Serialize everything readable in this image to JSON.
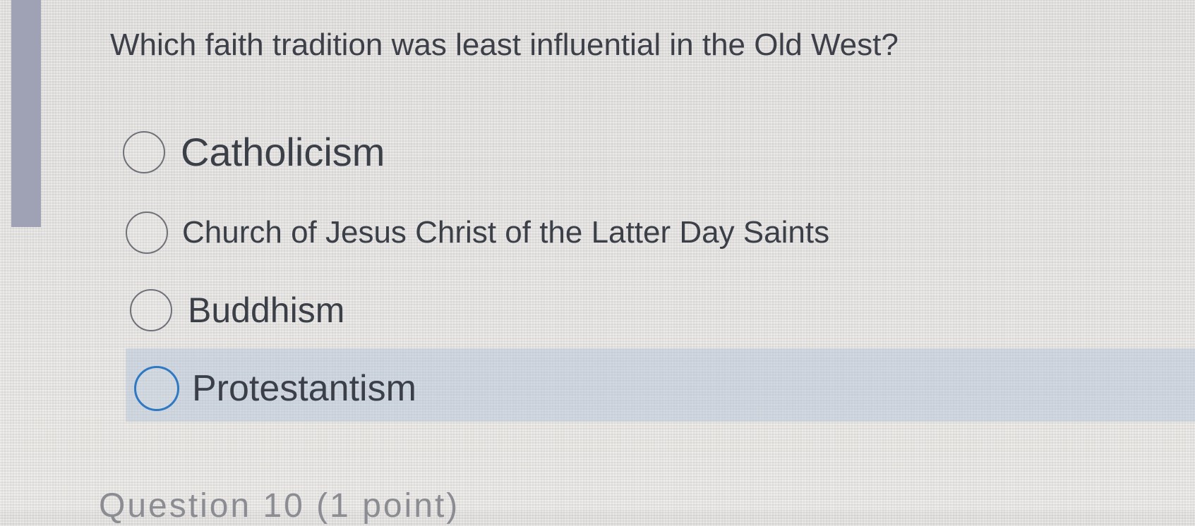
{
  "question": {
    "text": "Which faith tradition was least influential in the Old West?"
  },
  "options": [
    {
      "label": "Catholicism",
      "selected": false
    },
    {
      "label": "Church of Jesus Christ of the Latter Day Saints",
      "selected": false
    },
    {
      "label": "Buddhism",
      "selected": false
    },
    {
      "label": "Protestantism",
      "selected": false,
      "focused": true
    }
  ],
  "next_question": {
    "label": "Question 10 (1 point)"
  },
  "colors": {
    "accent_bar": "#9fa1b4",
    "focus_ring": "#2f78c4",
    "highlight": "#b0c0d6"
  }
}
